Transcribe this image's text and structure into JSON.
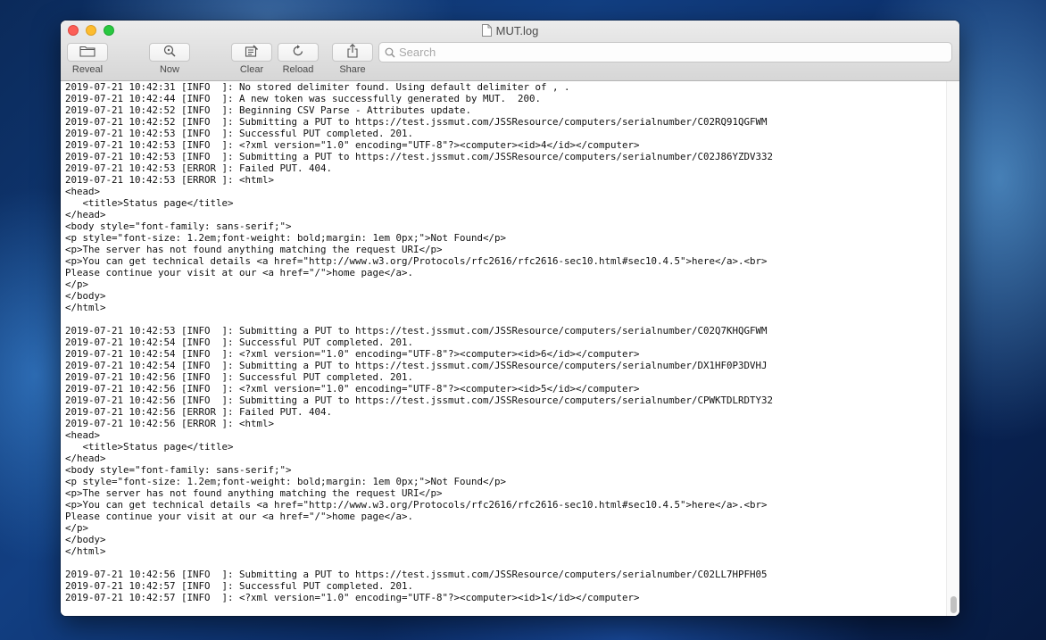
{
  "window": {
    "title": "MUT.log"
  },
  "toolbar": {
    "reveal_label": "Reveal",
    "now_label": "Now",
    "clear_label": "Clear",
    "reload_label": "Reload",
    "share_label": "Share"
  },
  "search": {
    "placeholder": "Search",
    "value": ""
  },
  "icons": {
    "reveal": "folder-icon",
    "now": "magnifier-icon",
    "clear": "clear-icon",
    "reload": "reload-icon",
    "share": "share-icon",
    "search": "search-icon",
    "title": "document-icon"
  },
  "colors": {
    "close": "#fc5f57",
    "minimize": "#fdbc2e",
    "zoom": "#28c840"
  },
  "log": {
    "lines": [
      "2019-07-21 10:42:31 [INFO  ]: No stored delimiter found. Using default delimiter of , .",
      "2019-07-21 10:42:44 [INFO  ]: A new token was successfully generated by MUT.  200.",
      "2019-07-21 10:42:52 [INFO  ]: Beginning CSV Parse - Attributes update.",
      "2019-07-21 10:42:52 [INFO  ]: Submitting a PUT to https://test.jssmut.com/JSSResource/computers/serialnumber/C02RQ91QGFWM",
      "2019-07-21 10:42:53 [INFO  ]: Successful PUT completed. 201.",
      "2019-07-21 10:42:53 [INFO  ]: <?xml version=\"1.0\" encoding=\"UTF-8\"?><computer><id>4</id></computer>",
      "2019-07-21 10:42:53 [INFO  ]: Submitting a PUT to https://test.jssmut.com/JSSResource/computers/serialnumber/C02J86YZDV332",
      "2019-07-21 10:42:53 [ERROR ]: Failed PUT. 404.",
      "2019-07-21 10:42:53 [ERROR ]: <html>",
      "<head>",
      "   <title>Status page</title>",
      "</head>",
      "<body style=\"font-family: sans-serif;\">",
      "<p style=\"font-size: 1.2em;font-weight: bold;margin: 1em 0px;\">Not Found</p>",
      "<p>The server has not found anything matching the request URI</p>",
      "<p>You can get technical details <a href=\"http://www.w3.org/Protocols/rfc2616/rfc2616-sec10.html#sec10.4.5\">here</a>.<br>",
      "Please continue your visit at our <a href=\"/\">home page</a>.",
      "</p>",
      "</body>",
      "</html>",
      "",
      "2019-07-21 10:42:53 [INFO  ]: Submitting a PUT to https://test.jssmut.com/JSSResource/computers/serialnumber/C02Q7KHQGFWM",
      "2019-07-21 10:42:54 [INFO  ]: Successful PUT completed. 201.",
      "2019-07-21 10:42:54 [INFO  ]: <?xml version=\"1.0\" encoding=\"UTF-8\"?><computer><id>6</id></computer>",
      "2019-07-21 10:42:54 [INFO  ]: Submitting a PUT to https://test.jssmut.com/JSSResource/computers/serialnumber/DX1HF0P3DVHJ",
      "2019-07-21 10:42:56 [INFO  ]: Successful PUT completed. 201.",
      "2019-07-21 10:42:56 [INFO  ]: <?xml version=\"1.0\" encoding=\"UTF-8\"?><computer><id>5</id></computer>",
      "2019-07-21 10:42:56 [INFO  ]: Submitting a PUT to https://test.jssmut.com/JSSResource/computers/serialnumber/CPWKTDLRDTY32",
      "2019-07-21 10:42:56 [ERROR ]: Failed PUT. 404.",
      "2019-07-21 10:42:56 [ERROR ]: <html>",
      "<head>",
      "   <title>Status page</title>",
      "</head>",
      "<body style=\"font-family: sans-serif;\">",
      "<p style=\"font-size: 1.2em;font-weight: bold;margin: 1em 0px;\">Not Found</p>",
      "<p>The server has not found anything matching the request URI</p>",
      "<p>You can get technical details <a href=\"http://www.w3.org/Protocols/rfc2616/rfc2616-sec10.html#sec10.4.5\">here</a>.<br>",
      "Please continue your visit at our <a href=\"/\">home page</a>.",
      "</p>",
      "</body>",
      "</html>",
      "",
      "2019-07-21 10:42:56 [INFO  ]: Submitting a PUT to https://test.jssmut.com/JSSResource/computers/serialnumber/C02LL7HPFH05",
      "2019-07-21 10:42:57 [INFO  ]: Successful PUT completed. 201.",
      "2019-07-21 10:42:57 [INFO  ]: <?xml version=\"1.0\" encoding=\"UTF-8\"?><computer><id>1</id></computer>"
    ]
  }
}
